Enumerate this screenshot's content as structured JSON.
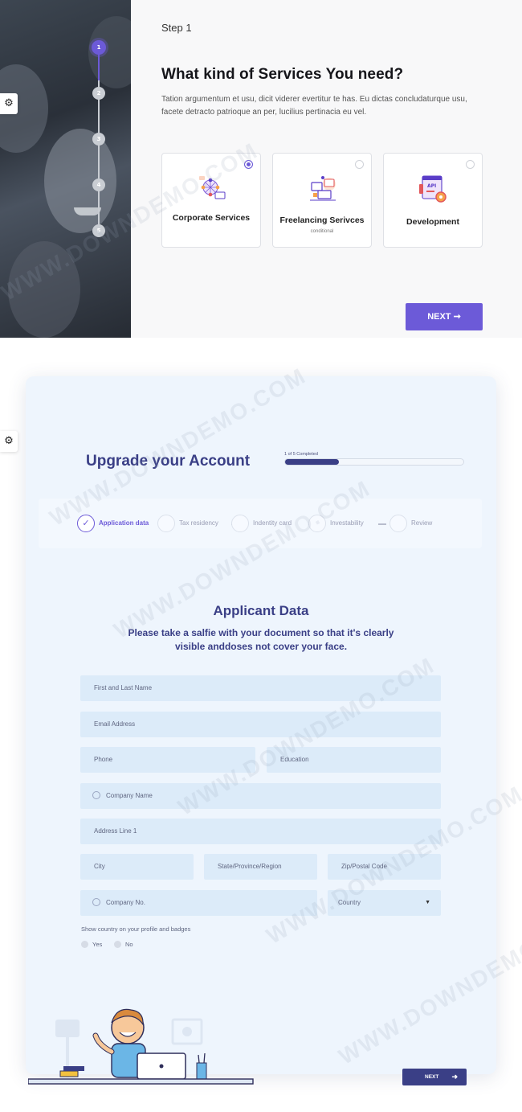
{
  "wizard": {
    "settings_icon": "gear-icon",
    "steps": [
      "1",
      "2",
      "3",
      "4",
      "5"
    ],
    "active_step": 1,
    "step_label": "Step 1",
    "title": "What kind of Services You need?",
    "description": "Tation argumentum et usu, dicit viderer evertitur te has. Eu dictas concludaturque usu, facete detracto patrioque an per, lucilius pertinacia eu vel.",
    "services": [
      {
        "name": "Corporate Services",
        "sub": "",
        "selected": true,
        "icon": "network-icon"
      },
      {
        "name": "Freelancing Serivces",
        "sub": "conditional",
        "selected": false,
        "icon": "workspace-icon"
      },
      {
        "name": "Development",
        "sub": "",
        "selected": false,
        "icon": "api-gear-icon"
      }
    ],
    "next_label": "NEXT",
    "next_icon": "arrow-right-icon",
    "accent": "#6c5ad8"
  },
  "account": {
    "title": "Upgrade your Account",
    "progress_label": "1 of 5 Completed",
    "progress_value": 0.3,
    "steps": [
      {
        "label": "Application data",
        "done": true
      },
      {
        "label": "Tax residency",
        "done": false
      },
      {
        "label": "Indentity card",
        "done": false
      },
      {
        "label": "Investability",
        "done": false
      },
      {
        "label": "Review",
        "done": false
      }
    ],
    "form_title": "Applicant Data",
    "form_subtitle": "Please take a salfie with your document so that it's clearly visible anddoses not cover your face.",
    "fields": {
      "full_name": "First and Last Name",
      "email": "Email Address",
      "phone": "Phone",
      "education": "Education",
      "company_name": "Company Name",
      "address1": "Address Line 1",
      "city": "City",
      "state": "State/Province/Region",
      "zip": "Zip/Postal Code",
      "company_no": "Company No.",
      "country": "Country"
    },
    "show_country_label": "Show country on your profile and badges",
    "options": [
      "Yes",
      "No"
    ],
    "next_label": "NEXT",
    "next_icon": "arrow-right-icon",
    "accent": "#3a3f86"
  },
  "watermark": "WWW.DOWNDEMO.COM"
}
